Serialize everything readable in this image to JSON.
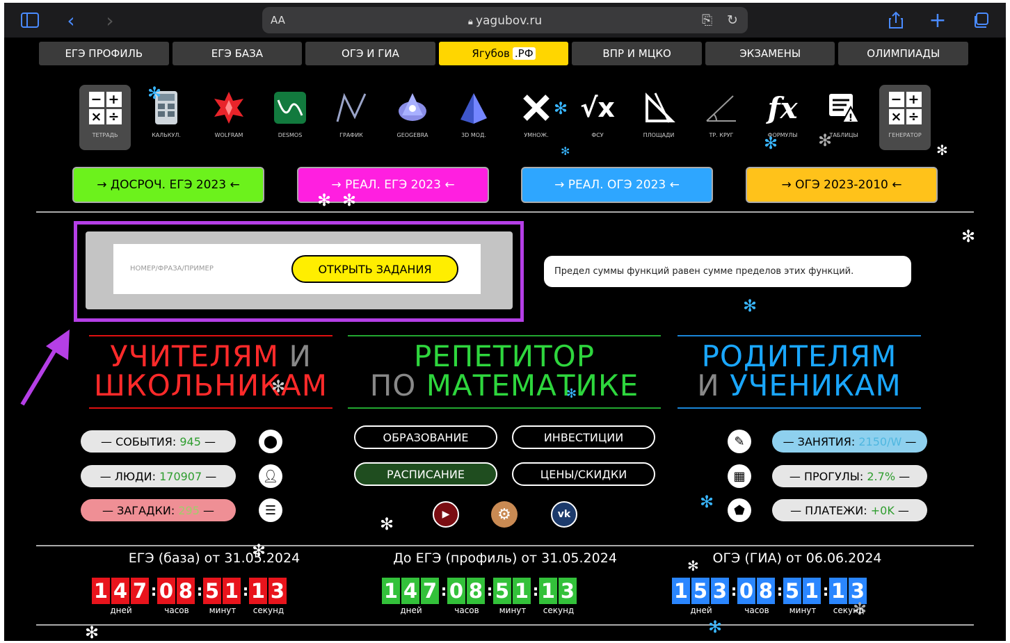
{
  "browser": {
    "text_size": "AA",
    "url": "yagubov.ru"
  },
  "nav": [
    {
      "label": "ЕГЭ ПРОФИЛЬ"
    },
    {
      "label": "ЕГЭ БАЗА"
    },
    {
      "label": "ОГЭ И ГИА"
    },
    {
      "label": "Ягубов",
      "suffix": ".РФ"
    },
    {
      "label": "ВПР И МЦКО"
    },
    {
      "label": "ЭКЗАМЕНЫ"
    },
    {
      "label": "ОЛИМПИАДЫ"
    }
  ],
  "tools": [
    {
      "label": "ТЕТРАДЬ",
      "icon": "calculator-icon"
    },
    {
      "label": "КАЛЬКУЛ.",
      "icon": "calculator-icon"
    },
    {
      "label": "WOLFRAM",
      "icon": "wolfram-icon"
    },
    {
      "label": "DESMOS",
      "icon": "desmos-icon"
    },
    {
      "label": "ГРАФИК",
      "icon": "graph-icon"
    },
    {
      "label": "GEOGEBRA",
      "icon": "geogebra-icon"
    },
    {
      "label": "3D МОД.",
      "icon": "pyramid-icon"
    },
    {
      "label": "УМНОЖ.",
      "icon": "multiply-icon"
    },
    {
      "label": "ФСУ",
      "icon": "sqrt-icon"
    },
    {
      "label": "ПЛОЩАДИ",
      "icon": "triangle-ruler-icon"
    },
    {
      "label": "ТР. КРУГ",
      "icon": "angle-icon"
    },
    {
      "label": "ФОРМУЛЫ",
      "icon": "fx-icon"
    },
    {
      "label": "ТАБЛИЦЫ",
      "icon": "table-warning-icon"
    },
    {
      "label": "ГЕНЕРАТОР",
      "icon": "calculator-icon"
    }
  ],
  "banners": [
    {
      "label": "→ ДОСРОЧ. ЕГЭ 2023 ←",
      "color": "#6cf21c"
    },
    {
      "label": "→ РЕАЛ. ЕГЭ 2023 ←",
      "color": "#ff1fe0"
    },
    {
      "label": "→ РЕАЛ. ОГЭ 2023 ←",
      "color": "#2ea6ff"
    },
    {
      "label": "→ ОГЭ 2023-2010 ←",
      "color": "#ffc21a"
    }
  ],
  "search": {
    "placeholder": "НОМЕР/ФРАЗА/ПРИМЕР",
    "button": "ОТКРЫТЬ ЗАДАНИЯ"
  },
  "quote": "Предел суммы функций равен сумме пределов этих функций.",
  "headings": {
    "teachers": {
      "line1a": "УЧИТЕЛЯМ",
      "line1b": "И",
      "line2": "ШКОЛЬНИКАМ",
      "color": "#ff2a2a"
    },
    "tutor": {
      "line1": "РЕПЕТИТОР",
      "line2a": "ПО",
      "line2b": "МАТЕМАТИКЕ",
      "color": "#2ed63d"
    },
    "parents": {
      "line1": "РОДИТЕЛЯМ",
      "line2a": "И",
      "line2b": "УЧЕНИКАМ",
      "color": "#1aa7ff"
    }
  },
  "stats_left": [
    {
      "label": "— СОБЫТИЯ:",
      "value": "945",
      "suffix": "—",
      "icon": "location-pin-icon"
    },
    {
      "label": "— ЛЮДИ:",
      "value": "170907",
      "suffix": "—",
      "icon": "contacts-icon"
    },
    {
      "label": "— ЗАГАДКИ:",
      "value": "295",
      "suffix": "—",
      "icon": "list-icon"
    }
  ],
  "center_buttons": [
    {
      "label": "ОБРАЗОВАНИЕ"
    },
    {
      "label": "ИНВЕСТИЦИИ"
    },
    {
      "label": "РАСПИСАНИЕ"
    },
    {
      "label": "ЦЕНЫ/СКИДКИ"
    }
  ],
  "social": [
    {
      "icon": "youtube-icon",
      "text": "▶"
    },
    {
      "icon": "settings-icon",
      "text": "⚙"
    },
    {
      "icon": "vk-icon",
      "text": "vk"
    }
  ],
  "stats_right": [
    {
      "label": "— ЗАНЯТИЯ:",
      "value": "2150/W",
      "suffix": "—",
      "icon": "pencil-icon"
    },
    {
      "label": "— ПРОГУЛЫ:",
      "value": "2.7%",
      "suffix": "—",
      "icon": "calendar-icon"
    },
    {
      "label": "— ПЛАТЕЖИ:",
      "value": "+0K",
      "suffix": "—",
      "icon": "tag-icon"
    }
  ],
  "countdowns": [
    {
      "title": "ЕГЭ (база) от 31.05.2024",
      "days": "147",
      "hours": "08",
      "minutes": "51",
      "seconds": "13",
      "color": "#e8141c"
    },
    {
      "title": "До ЕГЭ (профиль) от 31.05.2024",
      "days": "147",
      "hours": "08",
      "minutes": "51",
      "seconds": "13",
      "color": "#33c13a"
    },
    {
      "title": "ОГЭ (ГИА) от 06.06.2024",
      "days": "153",
      "hours": "08",
      "minutes": "51",
      "seconds": "13",
      "color": "#2a86ff"
    }
  ],
  "countdown_labels": {
    "days": "дней",
    "hours": "часов",
    "minutes": "минут",
    "seconds": "секунд"
  }
}
